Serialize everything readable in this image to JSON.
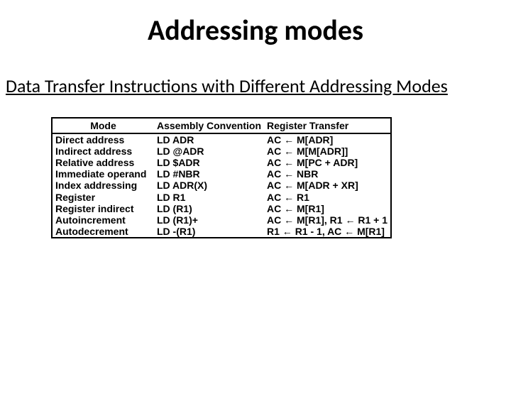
{
  "title": "Addressing modes",
  "subtitle": "Data Transfer Instructions with Different Addressing Modes",
  "headers": {
    "mode": "Mode",
    "asm": "Assembly Convention",
    "rt": "Register Transfer"
  },
  "rows": [
    {
      "mode": "Direct address",
      "asm": "LD  ADR",
      "rt": "AC ← M[ADR]"
    },
    {
      "mode": "Indirect address",
      "asm": "LD  @ADR",
      "rt": "AC ← M[M[ADR]]"
    },
    {
      "mode": "Relative address",
      "asm": "LD  $ADR",
      "rt": "AC ← M[PC + ADR]"
    },
    {
      "mode": "Immediate operand",
      "asm": "LD  #NBR",
      "rt": "AC ← NBR"
    },
    {
      "mode": "Index addressing",
      "asm": "LD  ADR(X)",
      "rt": "AC ← M[ADR + XR]"
    },
    {
      "mode": "Register",
      "asm": "LD  R1",
      "rt": "AC ← R1"
    },
    {
      "mode": "Register indirect",
      "asm": "LD  (R1)",
      "rt": "AC ← M[R1]"
    },
    {
      "mode": "Autoincrement",
      "asm": "LD  (R1)+",
      "rt": "AC ← M[R1], R1 ← R1 + 1"
    },
    {
      "mode": "Autodecrement",
      "asm": "LD  -(R1)",
      "rt": "R1 ← R1 - 1, AC ← M[R1]"
    }
  ]
}
